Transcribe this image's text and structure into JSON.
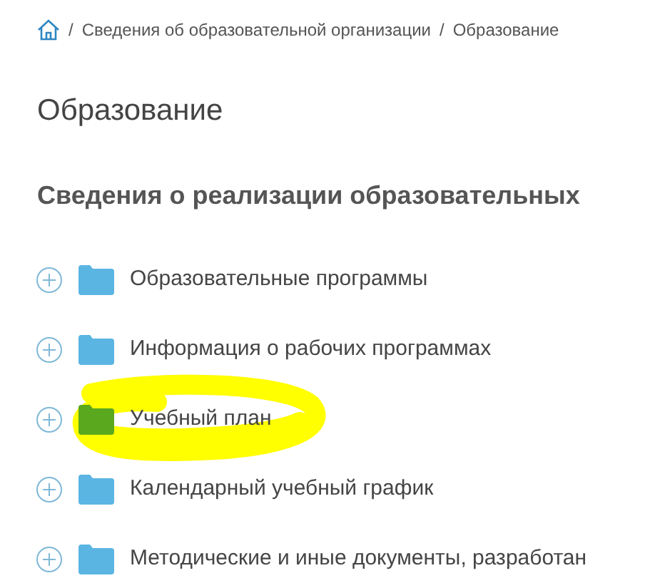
{
  "breadcrumb_separator": "/",
  "breadcrumb": [
    {
      "label": "Сведения об образовательной организации"
    },
    {
      "label": "Образование"
    }
  ],
  "title": "Образование",
  "section_heading": "Сведения о реализации образовательных",
  "items": [
    {
      "label": "Образовательные программы",
      "expanded": false,
      "highlighted": false
    },
    {
      "label": "Информация о рабочих программах",
      "expanded": false,
      "highlighted": false
    },
    {
      "label": "Учебный план",
      "expanded": false,
      "highlighted": true
    },
    {
      "label": "Календарный учебный график",
      "expanded": false,
      "highlighted": false
    },
    {
      "label": "Методические и иные документы, разработан",
      "expanded": false,
      "highlighted": false
    }
  ]
}
